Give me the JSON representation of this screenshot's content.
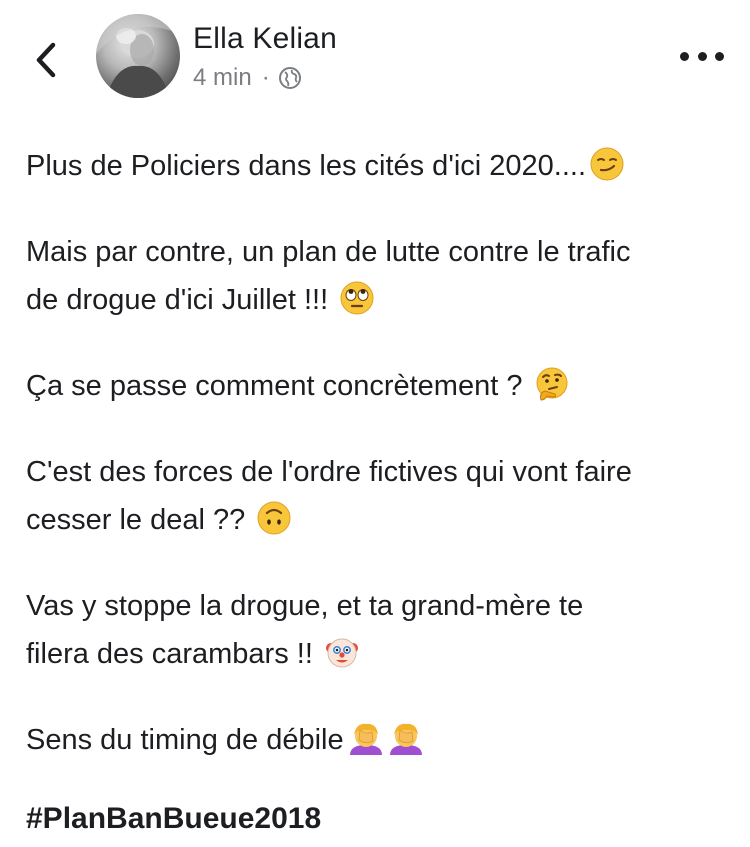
{
  "post": {
    "author": "Ella Kelian",
    "time": "4 min",
    "separator": "·",
    "privacy_icon": "globe-icon",
    "paragraphs": [
      {
        "text": "Plus de Policiers dans les cités d'ici 2020....",
        "emoji": "smirk-emoji"
      },
      {
        "text": "Mais par contre,  un plan de lutte contre le trafic",
        "text2": "de drogue d'ici Juillet !!!",
        "emoji": "eye-roll-emoji"
      },
      {
        "text": "Ça se passe comment concrètement ?",
        "emoji": "thinking-emoji"
      },
      {
        "text": "C'est des forces de l'ordre fictives qui vont faire",
        "text2": "cesser le deal ??",
        "emoji": "upside-down-emoji"
      },
      {
        "text": "Vas y stoppe  la drogue,  et ta grand-mère te",
        "text2": "filera des carambars !! ",
        "emoji": "clown-emoji"
      },
      {
        "text": "Sens du timing de débile",
        "emoji": "facepalm-emoji"
      }
    ],
    "hashtag": "#PlanBanBueue2018"
  },
  "icons": {
    "back": "chevron-left-icon",
    "more": "more-options-icon"
  },
  "colors": {
    "text": "#1c1e21",
    "meta": "#7a7d82",
    "background": "#ffffff"
  }
}
